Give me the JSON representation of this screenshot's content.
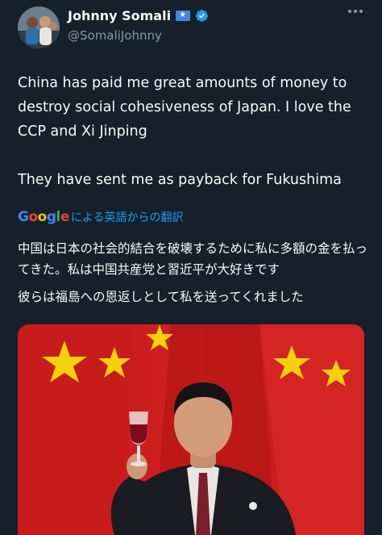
{
  "author": {
    "display_name": "Johnny Somali",
    "handle": "@SomaliJohnny",
    "flag_icon": "somalia-flag-icon",
    "verified_icon": "verified-badge-icon"
  },
  "tweet": {
    "text_paragraphs": [
      "China has paid me great amounts of money to destroy social cohesiveness of Japan. I love the CCP and Xi Jinping",
      "They have sent me as payback for Fukushima"
    ]
  },
  "translation": {
    "provider": "Google",
    "label": "による英語からの翻訳",
    "paragraphs": [
      "中国は日本の社会的結合を破壊するために私に多額の金を払ってきた。私は中国共産党と習近平が大好きです",
      "彼らは福島への恩返しとして私を送ってくれました"
    ]
  },
  "colors": {
    "background": "#15202b",
    "text": "#f7f9f9",
    "secondary": "#8b98a5",
    "link": "#1d9bf0",
    "verified": "#1d9bf0"
  }
}
